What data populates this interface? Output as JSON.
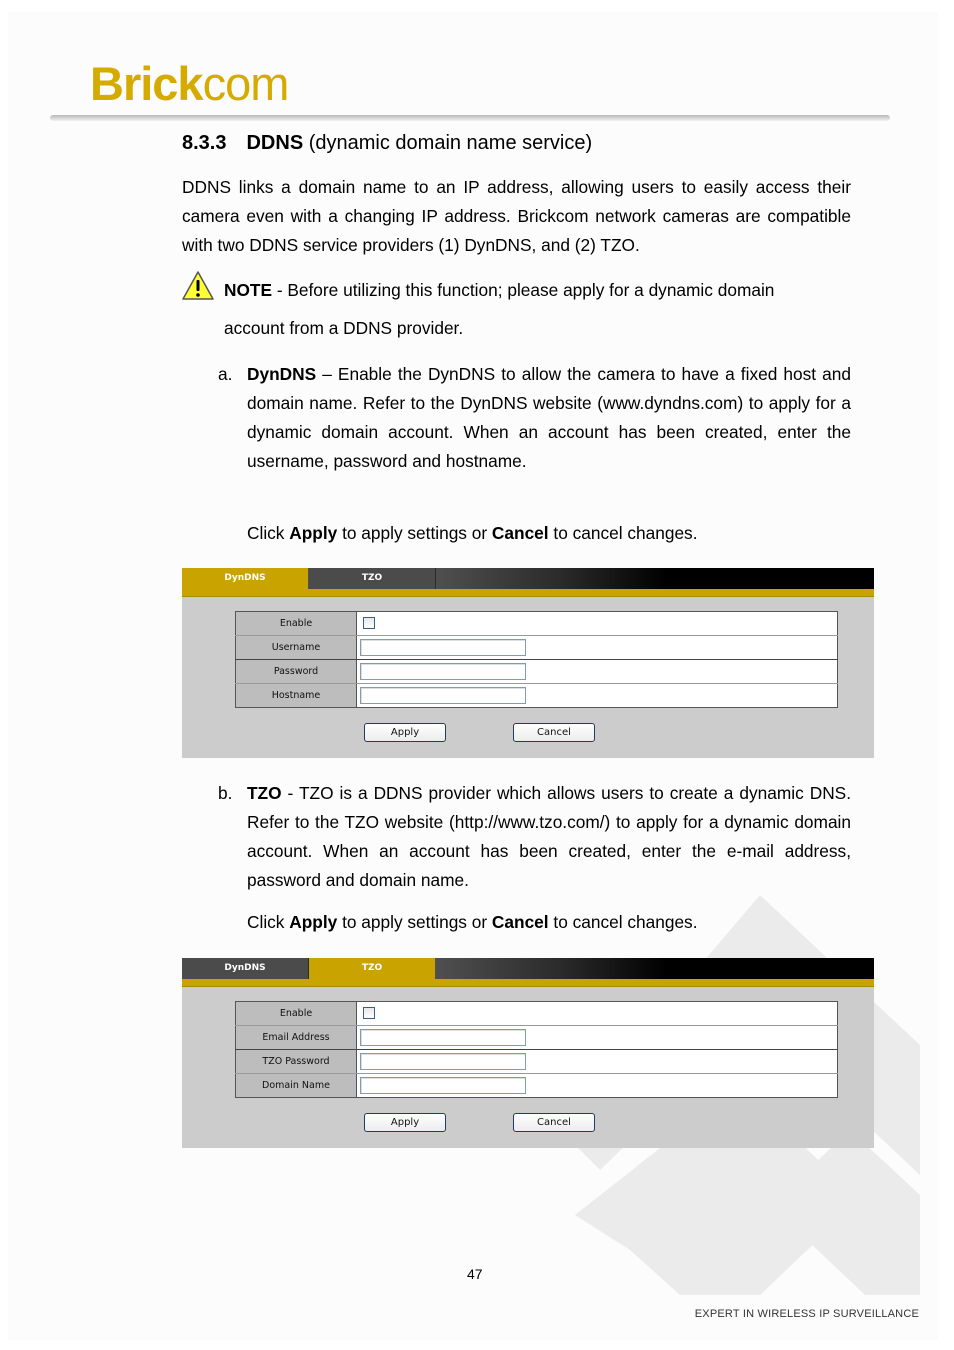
{
  "header": {
    "logo_bold": "Brick",
    "logo_light": "com",
    "brand_color": "#d6ab00"
  },
  "section": {
    "number": "8.3.3",
    "keyword": "DDNS",
    "subtitle": "(dynamic domain name service)"
  },
  "intro": "DDNS links a domain name to an IP address, allowing users to easily access their camera even with a changing IP address.  Brickcom network cameras are compatible with two DDNS service providers (1) DynDNS, and (2) TZO.",
  "note": {
    "icon": "warning-icon",
    "label": "NOTE",
    "line1": " - Before utilizing this function; please apply for a dynamic domain",
    "line2": "account from a DDNS provider."
  },
  "items": [
    {
      "marker": "a.",
      "keyword": "DynDNS",
      "text": " – Enable the DynDNS to allow the camera to have a fixed host and domain name.  Refer to the DynDNS website (www.dyndns.com) to apply for a dynamic domain account.  When an account has been created, enter the username, password and hostname.",
      "click": {
        "pre": "Click ",
        "apply": "Apply",
        "mid": " to apply settings or ",
        "cancel": "Cancel",
        "post": " to cancel changes."
      }
    },
    {
      "marker": "b.",
      "keyword": "TZO",
      "text": " - TZO is a DDNS provider which allows users to create a dynamic DNS.  Refer to the TZO website (http://www.tzo.com/) to apply for a dynamic domain account. When an account has been created, enter the e-mail address, password and domain name.",
      "click": {
        "pre": "Click ",
        "apply": "Apply",
        "mid": " to apply settings or ",
        "cancel": "Cancel",
        "post": " to cancel changes."
      }
    }
  ],
  "panels": [
    {
      "tabs": [
        {
          "label": "DynDNS",
          "active": true
        },
        {
          "label": "TZO",
          "active": false
        }
      ],
      "fields": [
        {
          "label": "Enable",
          "type": "checkbox",
          "checked": false
        },
        {
          "label": "Username",
          "type": "text",
          "value": ""
        },
        {
          "label": "Password",
          "type": "text",
          "value": ""
        },
        {
          "label": "Hostname",
          "type": "text",
          "value": ""
        }
      ],
      "apply_label": "Apply",
      "cancel_label": "Cancel"
    },
    {
      "tabs": [
        {
          "label": "DynDNS",
          "active": false
        },
        {
          "label": "TZO",
          "active": true
        }
      ],
      "fields": [
        {
          "label": "Enable",
          "type": "checkbox",
          "checked": false
        },
        {
          "label": "Email Address",
          "type": "text",
          "value": ""
        },
        {
          "label": "TZO Password",
          "type": "text",
          "value": ""
        },
        {
          "label": "Domain Name",
          "type": "text",
          "value": ""
        }
      ],
      "apply_label": "Apply",
      "cancel_label": "Cancel"
    }
  ],
  "page_number": "47",
  "footer": "EXPERT IN WIRELESS IP SURVEILLANCE"
}
